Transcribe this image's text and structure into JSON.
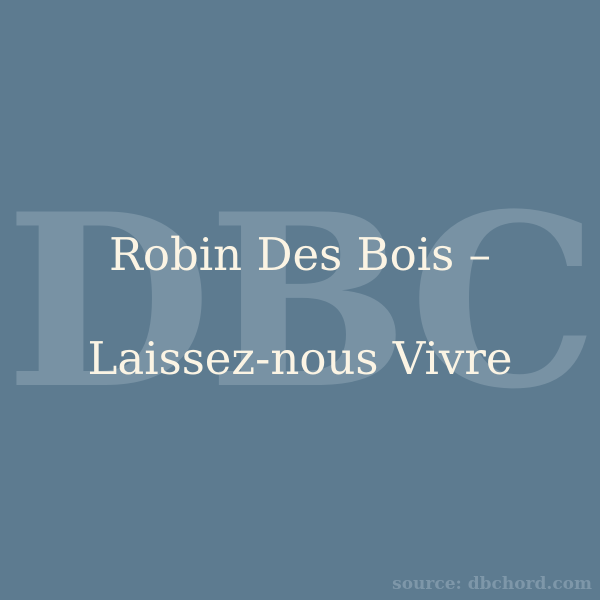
{
  "background_color": "#5d7b90",
  "watermark": {
    "text": "DBC",
    "color": "#7892a4"
  },
  "title": {
    "line_1": "Robin Des Bois –",
    "line_2": "Laissez-nous Vivre",
    "color": "#fbf4e4"
  },
  "source": {
    "text": "source: dbchord.com",
    "color": "#7e97a9"
  }
}
